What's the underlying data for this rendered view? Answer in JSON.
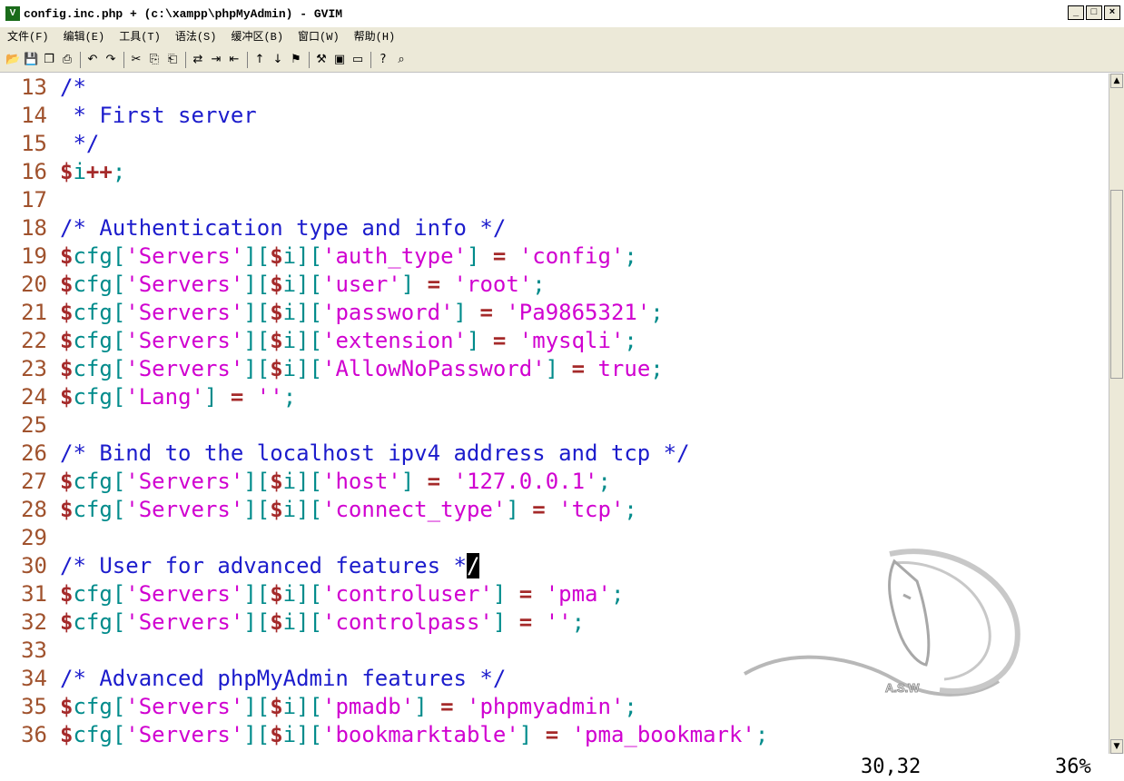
{
  "window": {
    "title": "config.inc.php + (c:\\xampp\\phpMyAdmin) - GVIM",
    "app_icon_letter": "V",
    "buttons": {
      "minimize": "_",
      "maximize": "□",
      "close": "×"
    }
  },
  "menu": [
    "文件(F)",
    "编辑(E)",
    "工具(T)",
    "语法(S)",
    "缓冲区(B)",
    "窗口(W)",
    "帮助(H)"
  ],
  "toolbar_icons": [
    "open-icon",
    "save-icon",
    "save-all-icon",
    "print-icon",
    "undo-icon",
    "redo-icon",
    "cut-icon",
    "copy-icon",
    "paste-icon",
    "replace-icon",
    "find-next-icon",
    "find-prev-icon",
    "load-session-icon",
    "save-session-icon",
    "run-script-icon",
    "make-icon",
    "shell-icon",
    "tags-icon",
    "help-icon",
    "find-help-icon"
  ],
  "code": [
    {
      "n": "13",
      "c": "/*"
    },
    {
      "n": "14",
      "c": " * First server"
    },
    {
      "n": "15",
      "c": " */"
    },
    {
      "n": "16",
      "c": "$i++;"
    },
    {
      "n": "17",
      "c": ""
    },
    {
      "n": "18",
      "c": "/* Authentication type and info */"
    },
    {
      "n": "19",
      "c": "$cfg['Servers'][$i]['auth_type'] = 'config';"
    },
    {
      "n": "20",
      "c": "$cfg['Servers'][$i]['user'] = 'root';"
    },
    {
      "n": "21",
      "c": "$cfg['Servers'][$i]['password'] = 'Pa9865321';"
    },
    {
      "n": "22",
      "c": "$cfg['Servers'][$i]['extension'] = 'mysqli';"
    },
    {
      "n": "23",
      "c": "$cfg['Servers'][$i]['AllowNoPassword'] = true;"
    },
    {
      "n": "24",
      "c": "$cfg['Lang'] = '';"
    },
    {
      "n": "25",
      "c": ""
    },
    {
      "n": "26",
      "c": "/* Bind to the localhost ipv4 address and tcp */"
    },
    {
      "n": "27",
      "c": "$cfg['Servers'][$i]['host'] = '127.0.0.1';"
    },
    {
      "n": "28",
      "c": "$cfg['Servers'][$i]['connect_type'] = 'tcp';"
    },
    {
      "n": "29",
      "c": ""
    },
    {
      "n": "30",
      "c": "/* User for advanced features */"
    },
    {
      "n": "31",
      "c": "$cfg['Servers'][$i]['controluser'] = 'pma';"
    },
    {
      "n": "32",
      "c": "$cfg['Servers'][$i]['controlpass'] = '';"
    },
    {
      "n": "33",
      "c": ""
    },
    {
      "n": "34",
      "c": "/* Advanced phpMyAdmin features */"
    },
    {
      "n": "35",
      "c": "$cfg['Servers'][$i]['pmadb'] = 'phpmyadmin';"
    },
    {
      "n": "36",
      "c": "$cfg['Servers'][$i]['bookmarktable'] = 'pma_bookmark';"
    }
  ],
  "cursor": {
    "line": "30",
    "column": "32"
  },
  "status": {
    "position": "30,32",
    "percent": "36%"
  },
  "watermark_text": "A.S.W",
  "colors": {
    "comment": "#1c1ccc",
    "variable": "#a52a2a",
    "identifier": "#008b8b",
    "string": "#d000d0",
    "line_number": "#a0522d"
  }
}
